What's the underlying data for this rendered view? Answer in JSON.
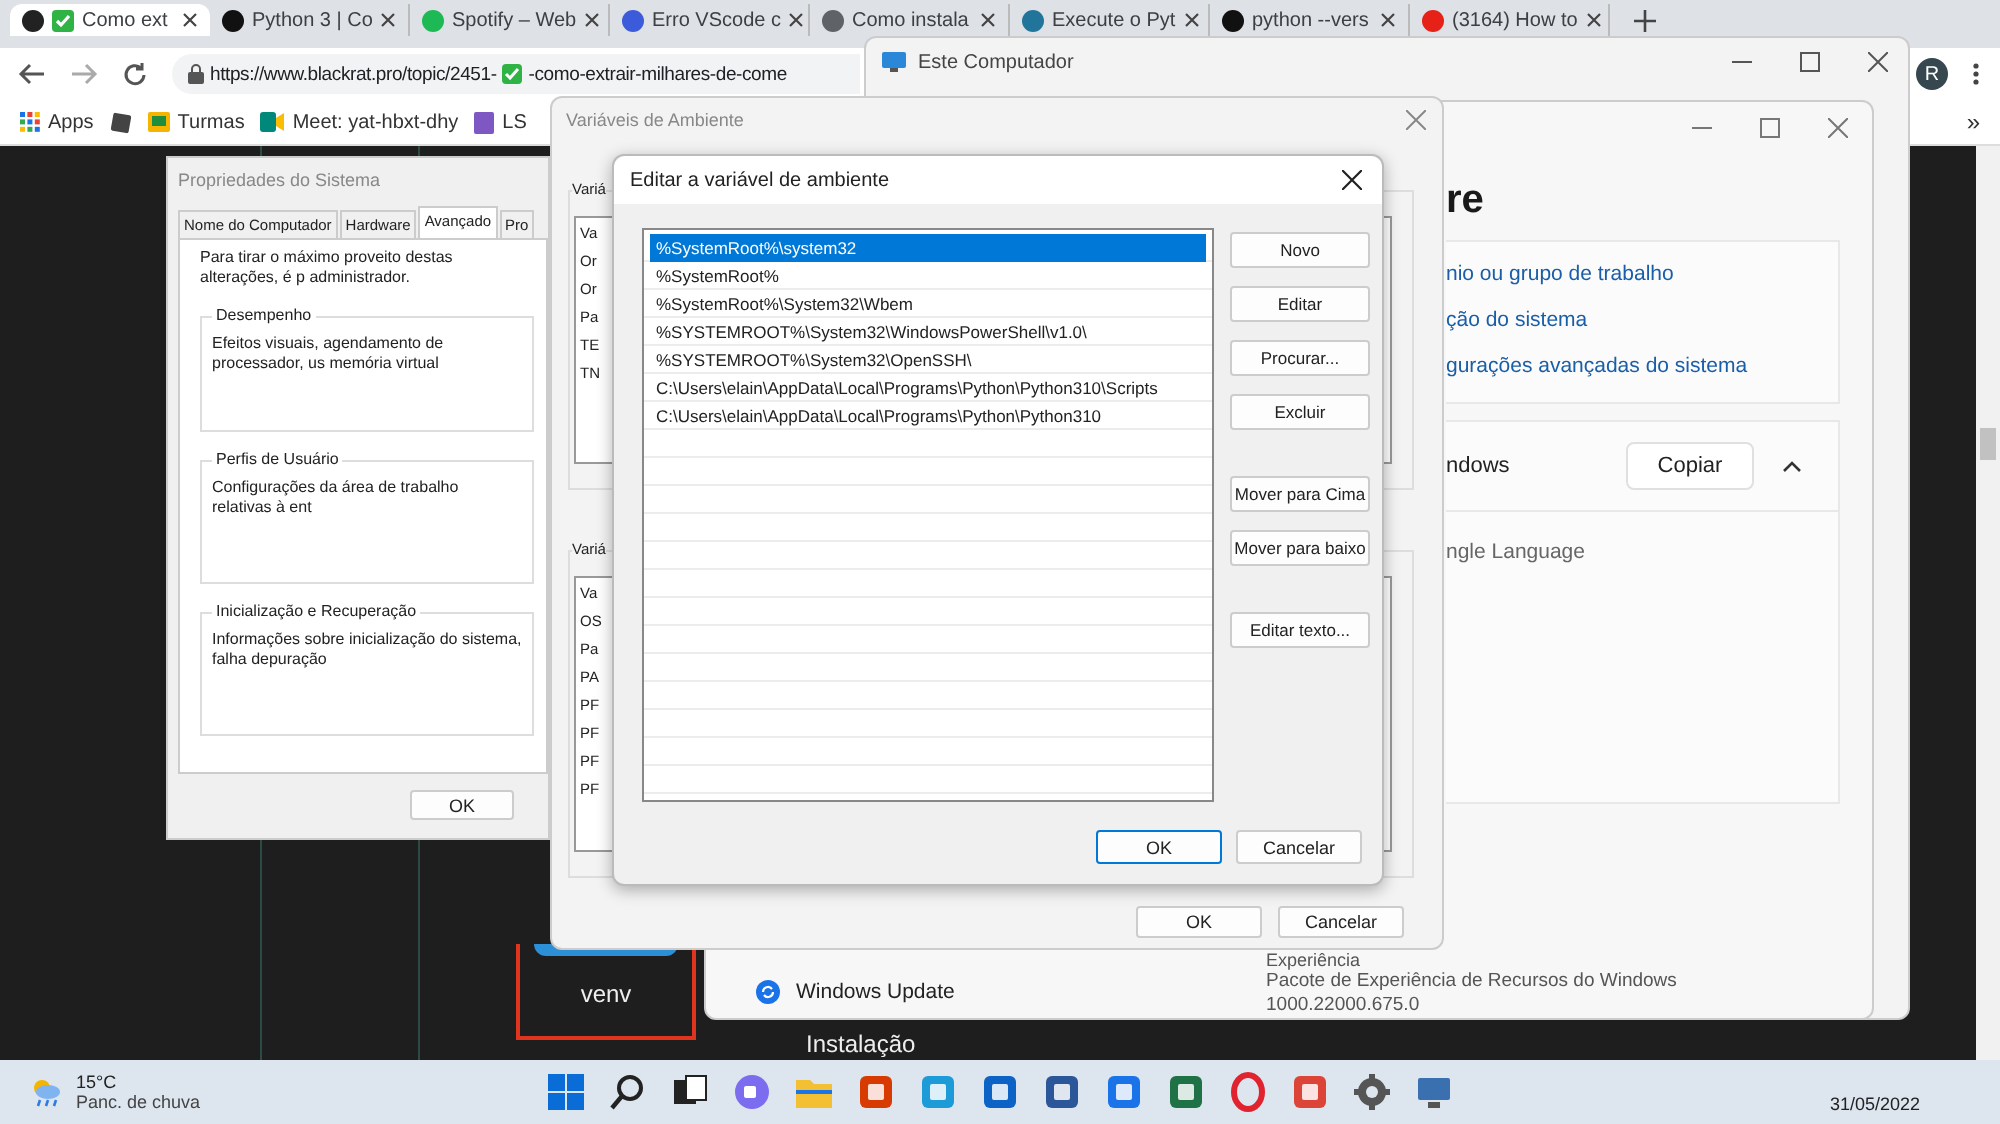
{
  "browser": {
    "tabs": [
      {
        "title": "Como ext",
        "selected": true
      },
      {
        "title": "Python 3 | Co",
        "selected": false
      },
      {
        "title": "Spotify – Web",
        "selected": false
      },
      {
        "title": "Erro VScode c",
        "selected": false
      },
      {
        "title": "Como instala",
        "selected": false
      },
      {
        "title": "Execute o Pyt",
        "selected": false
      },
      {
        "title": "python --vers",
        "selected": false
      },
      {
        "title": "(3164) How to",
        "selected": false
      }
    ],
    "address": "https://www.blackrat.pro/topic/2451-",
    "address_tail": "-como-extrair-milhares-de-come",
    "avatar_initial": "R",
    "bookmarks": [
      "Apps",
      "Turmas",
      "Meet: yat-hbxt-dhy",
      "LS"
    ],
    "bookmarks_more": "»",
    "page": {
      "label": "venv",
      "heading": "Instalação"
    }
  },
  "este_computador": {
    "title": "Este Computador"
  },
  "sobre": {
    "heading": "re",
    "links": [
      "nio ou grupo de trabalho",
      "ção do sistema",
      "gurações avançadas do sistema"
    ],
    "section": "ndows",
    "copy_button": "Copiar",
    "detail": "ngle Language",
    "nav_item": "Windows Update",
    "edition_label": "Experiência",
    "edition_value": "Pacote de Experiência de Recursos do Windows",
    "version": "1000.22000.675.0"
  },
  "system_properties": {
    "title": "Propriedades do Sistema",
    "tabs": [
      {
        "label": "Nome do Computador",
        "selected": false
      },
      {
        "label": "Hardware",
        "selected": false
      },
      {
        "label": "Avançado",
        "selected": true
      },
      {
        "label": "Pro",
        "selected": false
      }
    ],
    "intro": "Para tirar o máximo proveito destas alterações, é p administrador.",
    "groups": [
      {
        "title": "Desempenho",
        "text": "Efeitos visuais, agendamento de processador, us memória virtual"
      },
      {
        "title": "Perfis de Usuário",
        "text": "Configurações da área de trabalho relativas à ent"
      },
      {
        "title": "Inicialização e Recuperação",
        "text": "Informações sobre inicialização do sistema, falha depuração"
      }
    ],
    "buttons": [
      "OK"
    ]
  },
  "environment_variables": {
    "title": "Variáveis de Ambiente",
    "user_group": {
      "label": "Variá",
      "header": "Va",
      "items": [
        "Or",
        "Or",
        "Pa",
        "TE",
        "TN"
      ]
    },
    "system_group": {
      "label": "Variá",
      "header": "Va",
      "items": [
        "OS",
        "Pa",
        "PA",
        "PF",
        "PF",
        "PF",
        "PF"
      ]
    },
    "buttons": [
      "OK",
      "Cancelar"
    ]
  },
  "edit_dialog": {
    "title": "Editar a variável de ambiente",
    "entries": [
      {
        "text": "%SystemRoot%\\system32",
        "selected": true
      },
      {
        "text": "%SystemRoot%",
        "selected": false
      },
      {
        "text": "%SystemRoot%\\System32\\Wbem",
        "selected": false
      },
      {
        "text": "%SYSTEMROOT%\\System32\\WindowsPowerShell\\v1.0\\",
        "selected": false
      },
      {
        "text": "%SYSTEMROOT%\\System32\\OpenSSH\\",
        "selected": false
      },
      {
        "text": "C:\\Users\\elain\\AppData\\Local\\Programs\\Python\\Python310\\Scripts",
        "selected": false
      },
      {
        "text": "C:\\Users\\elain\\AppData\\Local\\Programs\\Python\\Python310",
        "selected": false
      }
    ],
    "side_buttons": [
      [
        "Novo",
        "Editar",
        "Procurar...",
        "Excluir"
      ],
      [
        "Mover para Cima",
        "Mover para baixo"
      ],
      [
        "Editar texto..."
      ]
    ],
    "buttons": [
      {
        "label": "OK",
        "default": true
      },
      {
        "label": "Cancelar",
        "default": false
      }
    ]
  },
  "taskbar": {
    "temperature": "15°C",
    "weather": "Panc. de chuva",
    "date": "31/05/2022"
  }
}
